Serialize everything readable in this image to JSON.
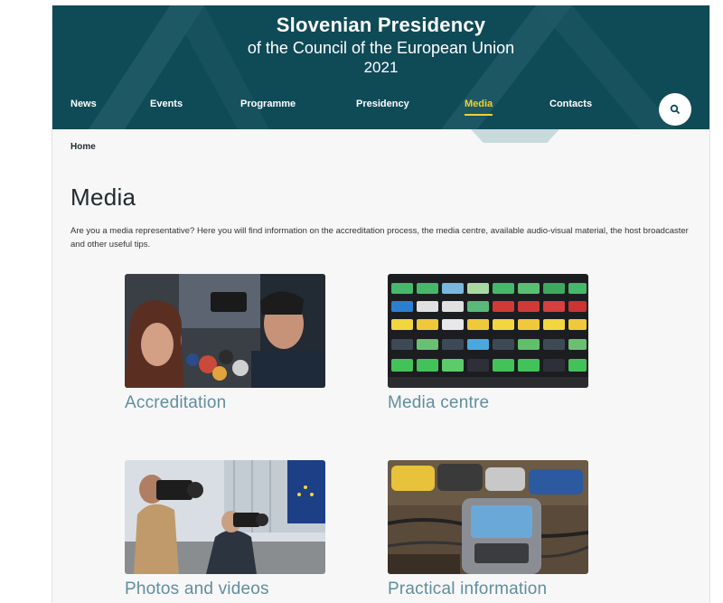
{
  "header": {
    "title": "Slovenian Presidency",
    "subtitle": "of the Council of the European Union",
    "year": "2021"
  },
  "nav": {
    "items": [
      {
        "label": "News"
      },
      {
        "label": "Events"
      },
      {
        "label": "Programme"
      },
      {
        "label": "Presidency"
      },
      {
        "label": "Media",
        "active": true
      },
      {
        "label": "Contacts"
      }
    ],
    "search_icon": "search-icon"
  },
  "breadcrumb": "Home",
  "page": {
    "title": "Media",
    "intro": "Are you a media representative? Here you will find information on the accreditation process, the media centre, available audio-visual material, the host broadcaster and other useful tips."
  },
  "cards": [
    {
      "label": "Accreditation",
      "image": "press-scrum-photo"
    },
    {
      "label": "Media centre",
      "image": "mixing-console-photo"
    },
    {
      "label": "Photos and videos",
      "image": "photographers-photo"
    },
    {
      "label": "Practical information",
      "image": "recorder-microphones-photo"
    }
  ],
  "colors": {
    "header_bg": "#0f4a57",
    "active_nav": "#f0d232",
    "card_label": "#5f8ea0"
  }
}
